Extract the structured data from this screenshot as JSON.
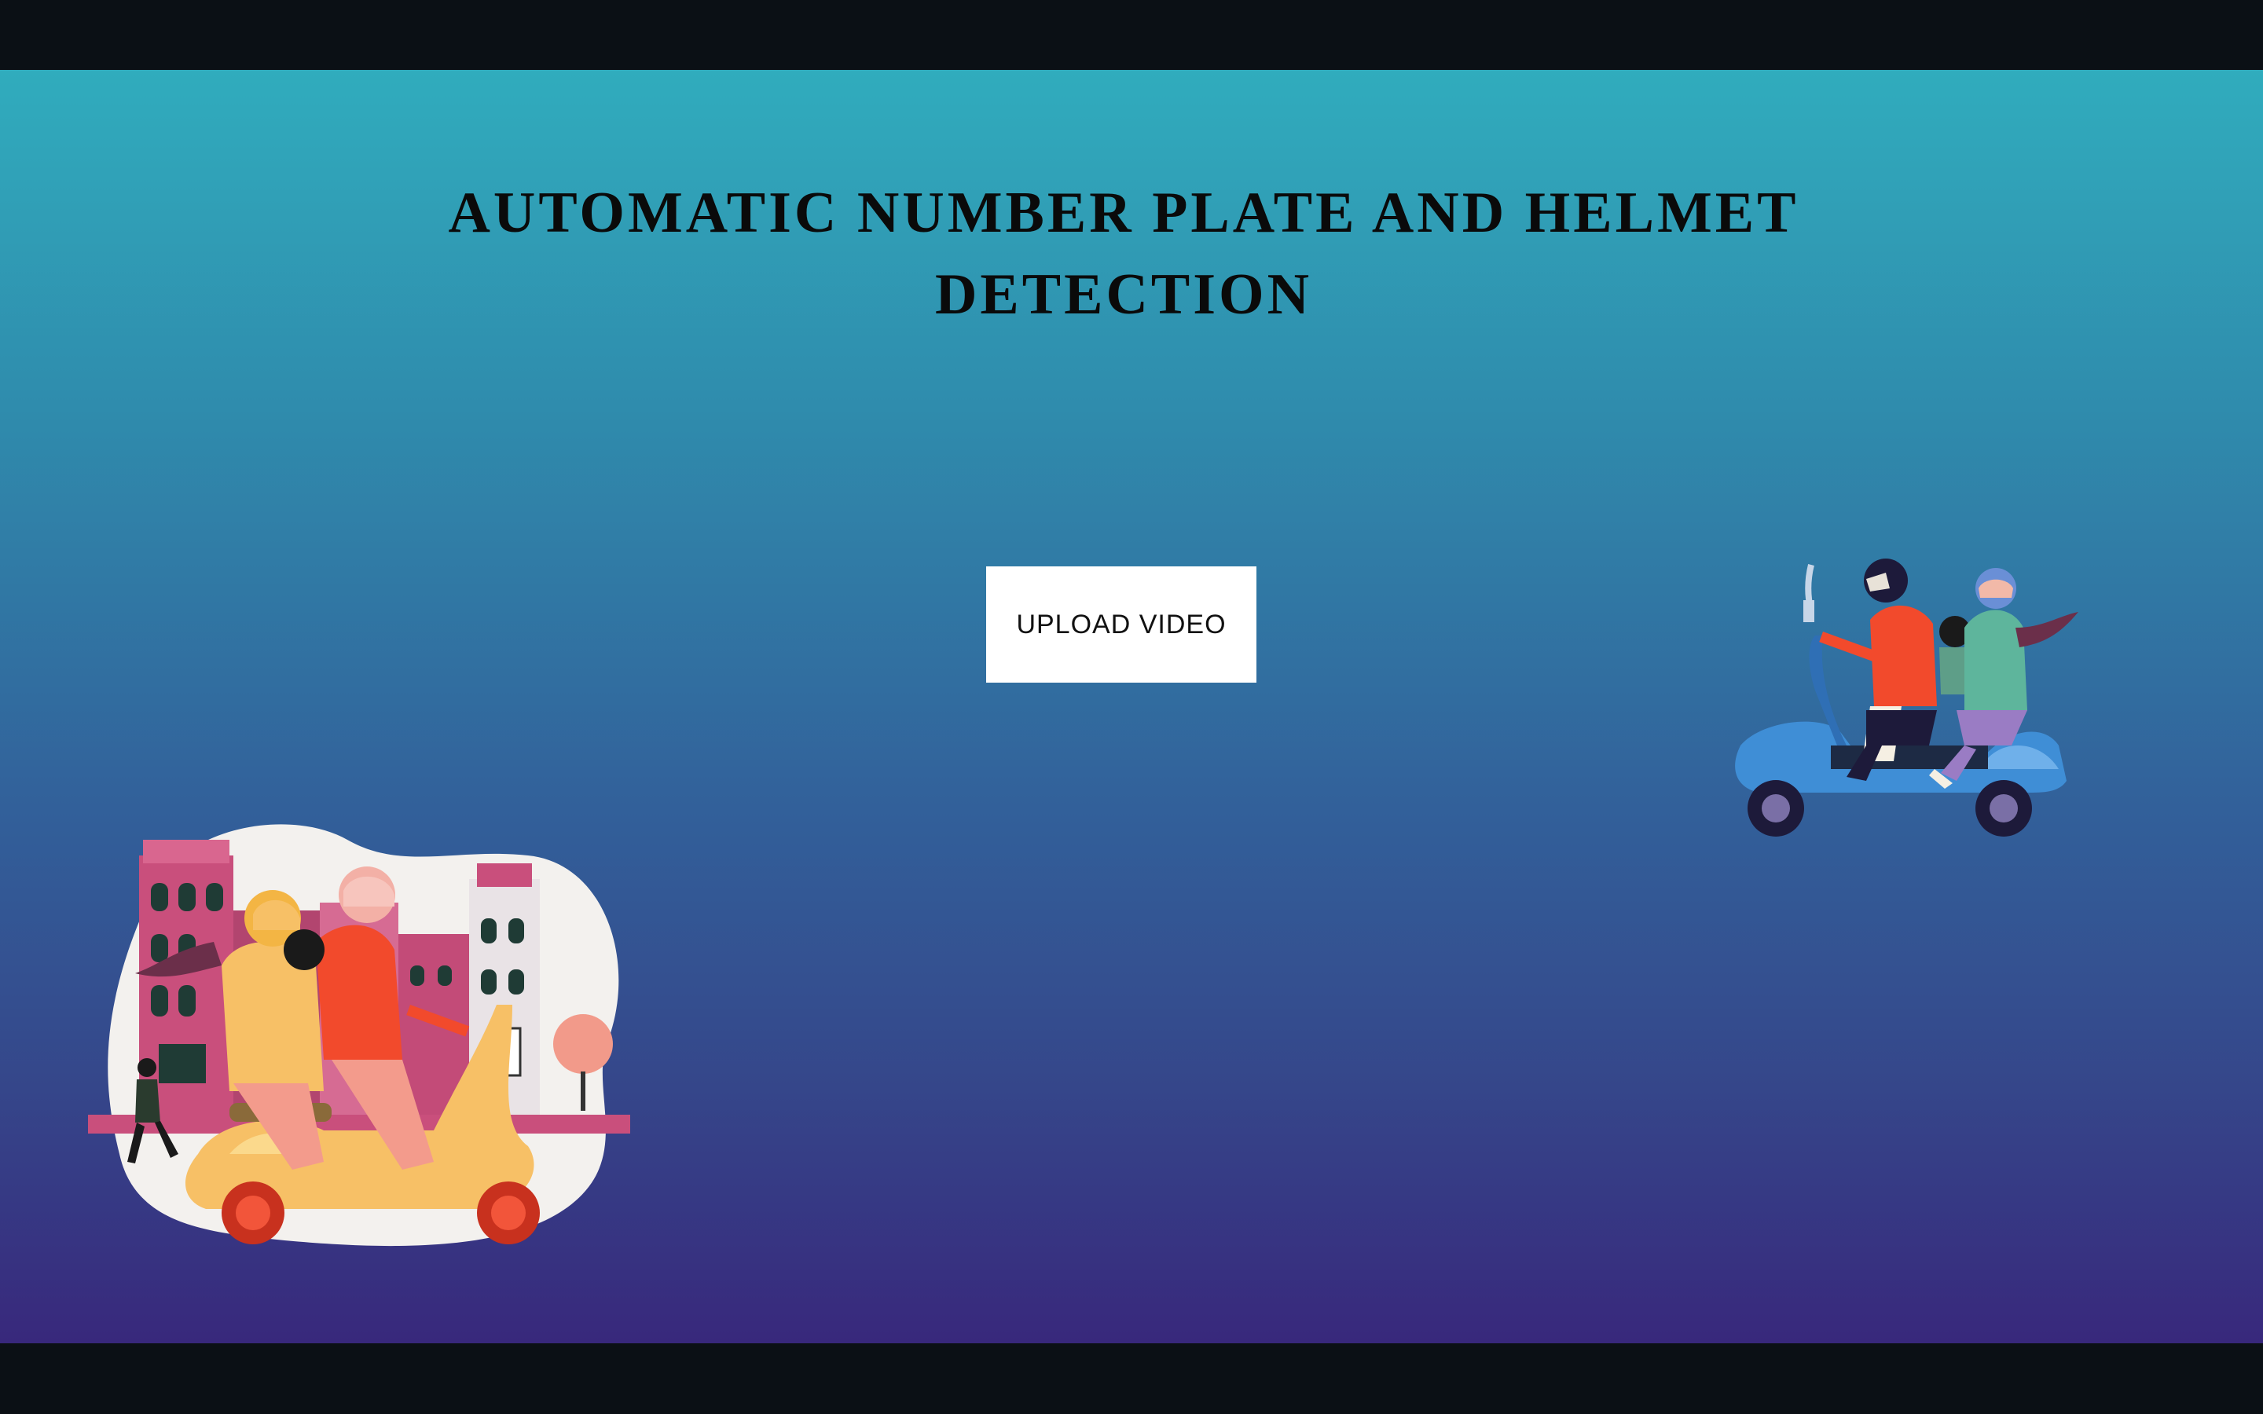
{
  "page": {
    "title": "AUTOMATIC NUMBER PLATE AND HELMET DETECTION"
  },
  "actions": {
    "upload_label": "UPLOAD VIDEO"
  },
  "illustrations": {
    "left": "scooter-riders-city-illustration",
    "right": "scooter-riders-illustration"
  },
  "colors": {
    "gradient_top": "#30acbd",
    "gradient_bottom": "#38287c",
    "letterbox": "#0b1015",
    "button_bg": "#ffffff",
    "title_text": "#0a0a0a"
  }
}
